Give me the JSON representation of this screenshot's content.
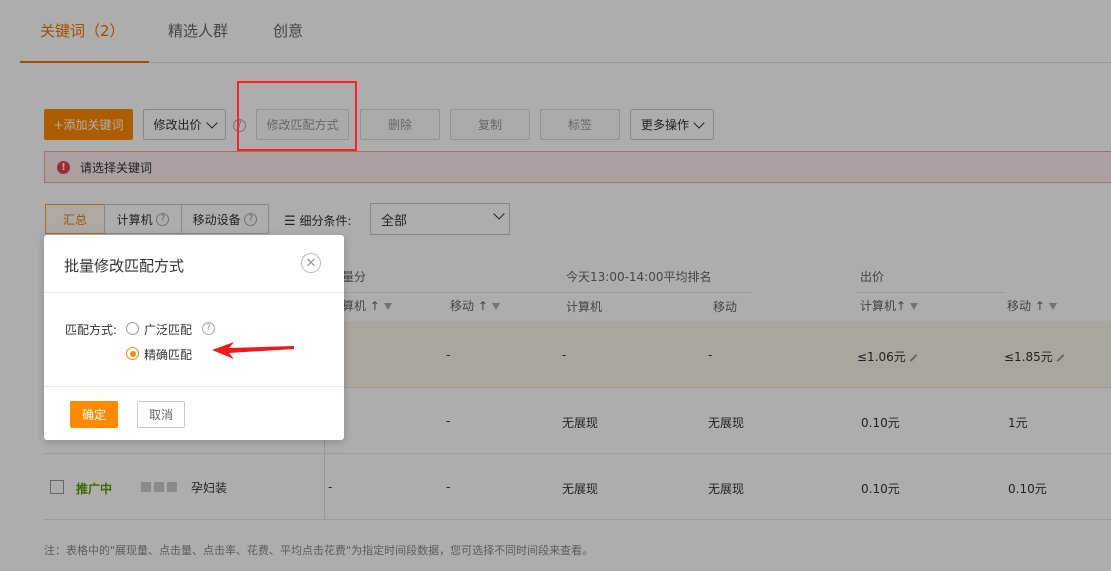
{
  "tabs": [
    {
      "label": "关键词（2）"
    },
    {
      "label": "精选人群"
    },
    {
      "label": "创意"
    }
  ],
  "toolbar": {
    "add_keyword": "+添加关键词",
    "modify_bid": "修改出价",
    "modify_match": "修改匹配方式",
    "delete": "删除",
    "copy": "复制",
    "tag": "标签",
    "more": "更多操作"
  },
  "warning": {
    "text": "请选择关键词"
  },
  "segments": {
    "summary": "汇总",
    "computer": "计算机",
    "mobile": "移动设备",
    "filter_label": "细分条件:",
    "filter_value": "全部"
  },
  "table": {
    "headers": {
      "group1": "量分",
      "group1_pc": "算机",
      "group1_mobile": "移动",
      "group2": "今天13:00-14:00平均排名",
      "group2_pc": "计算机",
      "group2_mobile": "移动",
      "group3": "出价",
      "group3_pc": "计算机",
      "group3_mobile": "移动"
    },
    "rows": [
      {
        "c1": "-",
        "c2": "-",
        "c3": "-",
        "c4": "-",
        "bid_pc": "≤1.06元",
        "bid_mobile": "≤1.85元"
      },
      {
        "c1": "-",
        "c2": "-",
        "c3": "无展现",
        "c4": "无展现",
        "bid_pc": "0.10元",
        "bid_mobile": "1元"
      },
      {
        "status": "推广中",
        "keyword": "孕妇装",
        "c1": "-",
        "c2": "-",
        "c3": "无展现",
        "c4": "无展现",
        "bid_pc": "0.10元",
        "bid_mobile": "0.10元"
      }
    ]
  },
  "footnote": "注：表格中的\"展现量、点击量、点击率、花费、平均点击花费\"为指定时间段数据，您可选择不同时间段来查看。",
  "modal": {
    "title": "批量修改匹配方式",
    "field_label": "匹配方式:",
    "option_broad": "广泛匹配",
    "option_exact": "精确匹配",
    "selected": "精确匹配",
    "confirm": "确定",
    "cancel": "取消"
  },
  "colors": {
    "accent": "#ff8a00",
    "status_green": "#5a9a00",
    "annotation_red": "#ff2020"
  }
}
